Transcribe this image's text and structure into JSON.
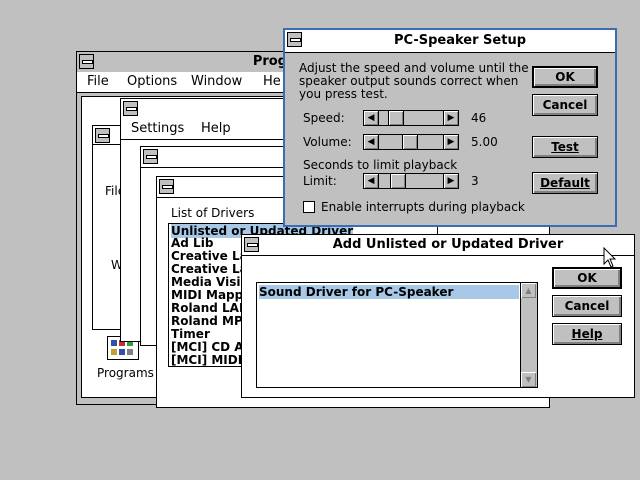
{
  "program_manager": {
    "title": "Prog",
    "menu": [
      "File",
      "Options",
      "Window",
      "He"
    ],
    "group_label": "Programs"
  },
  "control_panel": {
    "menu": [
      "Settings",
      "Help"
    ],
    "fragments": [
      "File",
      "W"
    ]
  },
  "drivers_window": {
    "list_label": "List of Drivers",
    "items": [
      "Unlisted or Updated Driver",
      "Ad Lib",
      "Creative Lab",
      "Creative Lab",
      "Media Vision",
      "MIDI Mappe",
      "Roland LAPC",
      "Roland MPU",
      "Timer",
      "[MCI] CD Au",
      "[MCI] MIDI S"
    ]
  },
  "pc_speaker_setup": {
    "title": "PC-Speaker Setup",
    "instructions": [
      "Adjust the speed and volume until the",
      "speaker output sounds correct when",
      "you press test."
    ],
    "speed_label": "Speed:",
    "speed_value": "46",
    "volume_label": "Volume:",
    "volume_value": "5.00",
    "seconds_label": "Seconds to limit playback",
    "limit_label": "Limit:",
    "limit_value": "3",
    "interrupts_label": "Enable interrupts during playback",
    "interrupts_checked": false,
    "ok_label": "OK",
    "cancel_label": "Cancel",
    "test_label": "Test",
    "default_label": "Default"
  },
  "add_driver": {
    "title": "Add Unlisted or Updated Driver",
    "items": [
      "Sound Driver for PC-Speaker"
    ],
    "ok_label": "OK",
    "cancel_label": "Cancel",
    "help_label": "Help"
  }
}
